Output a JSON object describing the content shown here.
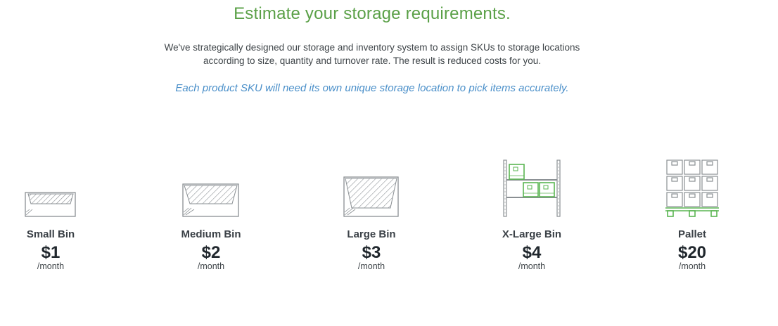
{
  "header": {
    "title": "Estimate your storage requirements.",
    "intro_line1": "We've strategically designed our storage and inventory system to assign SKUs to storage locations",
    "intro_line2": "according to size, quantity and turnover rate. The result is reduced costs for you.",
    "note": "Each product SKU will need its own unique storage location to pick items accurately."
  },
  "tiers": [
    {
      "name": "Small Bin",
      "price": "$1",
      "unit": "/month",
      "icon": "small-bin-icon"
    },
    {
      "name": "Medium Bin",
      "price": "$2",
      "unit": "/month",
      "icon": "medium-bin-icon"
    },
    {
      "name": "Large Bin",
      "price": "$3",
      "unit": "/month",
      "icon": "large-bin-icon"
    },
    {
      "name": "X-Large Bin",
      "price": "$4",
      "unit": "/month",
      "icon": "shelf-rack-icon"
    },
    {
      "name": "Pallet",
      "price": "$20",
      "unit": "/month",
      "icon": "pallet-icon"
    }
  ],
  "colors": {
    "heading": "#5aa047",
    "note": "#4a8fc9",
    "accent_green": "#5ab552",
    "sketch_gray": "#8a8f93"
  }
}
